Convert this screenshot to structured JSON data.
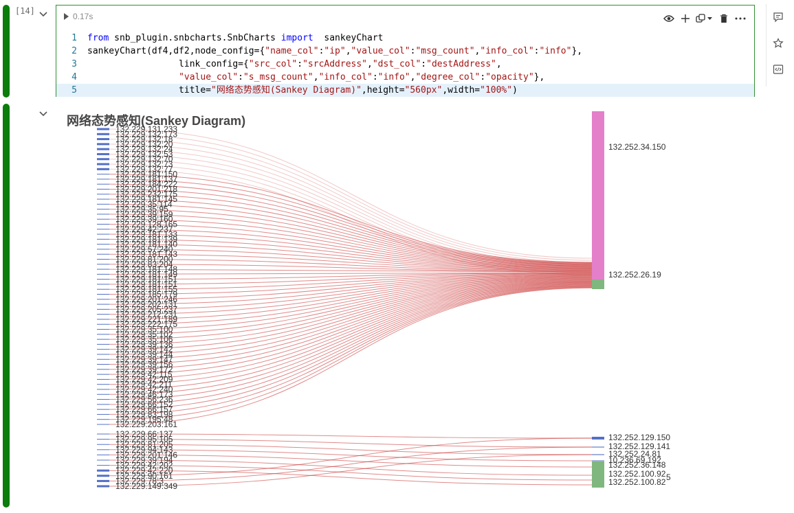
{
  "cell": {
    "execution_count": "[14]",
    "run_time": "0.17s",
    "code_lines": [
      {
        "n": "1",
        "parts": [
          [
            "kw",
            "from"
          ],
          [
            "t",
            " snb_plugin.snbcharts.SnbCharts "
          ],
          [
            "kw",
            "import"
          ],
          [
            "t",
            "  sankeyChart"
          ]
        ]
      },
      {
        "n": "2",
        "parts": [
          [
            "t",
            "sankeyChart(df4,df2,node_config={"
          ],
          [
            "str",
            "\"name_col\""
          ],
          [
            "t",
            ":"
          ],
          [
            "str",
            "\"ip\""
          ],
          [
            "t",
            ","
          ],
          [
            "str",
            "\"value_col\""
          ],
          [
            "t",
            ":"
          ],
          [
            "str",
            "\"msg_count\""
          ],
          [
            "t",
            ","
          ],
          [
            "str",
            "\"info_col\""
          ],
          [
            "t",
            ":"
          ],
          [
            "str",
            "\"info\""
          ],
          [
            "t",
            "},"
          ]
        ]
      },
      {
        "n": "3",
        "parts": [
          [
            "t",
            "                 link_config={"
          ],
          [
            "str",
            "\"src_col\""
          ],
          [
            "t",
            ":"
          ],
          [
            "str",
            "\"srcAddress\""
          ],
          [
            "t",
            ","
          ],
          [
            "str",
            "\"dst_col\""
          ],
          [
            "t",
            ":"
          ],
          [
            "str",
            "\"destAddress\""
          ],
          [
            "t",
            ","
          ]
        ]
      },
      {
        "n": "4",
        "parts": [
          [
            "t",
            "                 "
          ],
          [
            "str",
            "\"value_col\""
          ],
          [
            "t",
            ":"
          ],
          [
            "str",
            "\"s_msg_count\""
          ],
          [
            "t",
            ","
          ],
          [
            "str",
            "\"info_col\""
          ],
          [
            "t",
            ":"
          ],
          [
            "str",
            "\"info\""
          ],
          [
            "t",
            ","
          ],
          [
            "str",
            "\"degree_col\""
          ],
          [
            "t",
            ":"
          ],
          [
            "str",
            "\"opacity\""
          ],
          [
            "t",
            "},"
          ]
        ]
      },
      {
        "n": "5",
        "parts": [
          [
            "t",
            "                 title="
          ],
          [
            "str",
            "\"网络态势感知(Sankey Diagram)\""
          ],
          [
            "t",
            ",height="
          ],
          [
            "str",
            "\"560px\""
          ],
          [
            "t",
            ",width="
          ],
          [
            "str",
            "\"100%\""
          ],
          [
            "t",
            ")"
          ]
        ]
      }
    ]
  },
  "toolbar": {
    "icons": [
      "eye-icon",
      "plus-icon",
      "copy-icon",
      "chevron-down-icon",
      "trash-icon",
      "more-icon"
    ]
  },
  "sidebar": {
    "icons": [
      "comment-icon",
      "star-icon",
      "code-icon"
    ]
  },
  "chart_data": {
    "type": "sankey",
    "title": "网络态势感知(Sankey Diagram)",
    "source_nodes": [
      "132.229.131.233",
      "132.229.132:173",
      "132.229.132:18",
      "132.229.132:20",
      "132.229.132:24",
      "132.229.132:53",
      "132.229.132:70",
      "132.229.132:73",
      "132.229.132:77",
      "132.229.181:150",
      "132.229.181:137",
      "132.229.184:222",
      "132.229.201:218",
      "132.229.232:175",
      "132.229.181:145",
      "132.229.35:114",
      "132.229.35:95",
      "132.229.39:159",
      "132.229.39:160",
      "132.229.128.165",
      "132.229.42:237",
      "132.229.181.133",
      "132.229.181:139",
      "132.229.181.140",
      "132.229.57:240",
      "132.229.181.143",
      "132.229.81:200",
      "132.229.83:204",
      "132.229.181.148",
      "132.229.181.149",
      "132.229.181:151",
      "132.229.181:151",
      "132.229.181:155",
      "132.229.185:179",
      "132.229.201:246",
      "132.229.202:131",
      "132.229.205:237",
      "132.229.212:231",
      "132.229.221:189",
      "132.229.222:175",
      "132.229.35:100",
      "132.229.35:102",
      "132.229.35:106",
      "132.229.39:136",
      "132.229.39:142",
      "132.229.39:144",
      "132.229.39:147",
      "132.229.39:156",
      "132.229.39:172",
      "132.229.42:115",
      "132.229.42:209",
      "132.229.42:211",
      "132.229.42:240",
      "132.229.46:173",
      "132.229.56:236",
      "132.229.66:152",
      "132.229.66:157",
      "132.229.83:198",
      "132.229.195:48",
      "132.229.203:161",
      "132.229.66:137",
      "132.229.95:105",
      "132.229.81:205",
      "132.229.94:143",
      "132.229.201:146",
      "132.229.39:194",
      "132.229.42:202",
      "132.229.42:220",
      "132.229.90:161",
      "132.229.78:3",
      "132.229.149:349"
    ],
    "target_nodes": [
      {
        "name": "132.252.34.150",
        "color": "#e47fc9"
      },
      {
        "name": "132.252.26.19",
        "color": "#7fb77e"
      },
      {
        "name": "132.252.129.150",
        "color": "#5470c6"
      },
      {
        "name": "132.252.129.141",
        "color": "#a0b0d8"
      },
      {
        "name": "132.252.24.81",
        "color": "#a0b0d8"
      },
      {
        "name": "10.236.69.192",
        "color": "#a0b0d8"
      },
      {
        "name": "132.252.36.148",
        "color": "#7fb77e"
      },
      {
        "name": "132.252.100.92",
        "color": "#7fb77e"
      },
      {
        "name": "5",
        "color": "#7fb77e"
      },
      {
        "name": "132.252.100.82",
        "color": "#7fb77e"
      }
    ],
    "link_color": "#c62828",
    "source_node_color": "#5470c6"
  }
}
